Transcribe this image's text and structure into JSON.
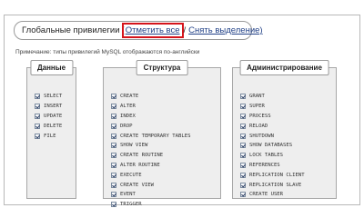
{
  "header": {
    "title": "Глобальные привилегии",
    "check_all": "Отметить все",
    "separator": "/",
    "uncheck_all": "Снять выделение)"
  },
  "note": "Примечание: типы привилегий MySQL отображаются по-английски",
  "panels": [
    {
      "title": "Данные",
      "items": [
        "SELECT",
        "INSERT",
        "UPDATE",
        "DELETE",
        "FILE"
      ]
    },
    {
      "title": "Структура",
      "items": [
        "CREATE",
        "ALTER",
        "INDEX",
        "DROP",
        "CREATE TEMPORARY TABLES",
        "SHOW VIEW",
        "CREATE ROUTINE",
        "ALTER ROUTINE",
        "EXECUTE",
        "CREATE VIEW",
        "EVENT",
        "TRIGGER"
      ]
    },
    {
      "title": "Администрирование",
      "items": [
        "GRANT",
        "SUPER",
        "PROCESS",
        "RELOAD",
        "SHUTDOWN",
        "SHOW DATABASES",
        "LOCK TABLES",
        "REFERENCES",
        "REPLICATION CLIENT",
        "REPLICATION SLAVE",
        "CREATE USER"
      ]
    }
  ],
  "colors": {
    "highlight_border": "#d5141b",
    "link": "#1f3f86",
    "panel_bg": "#eeeeee"
  }
}
